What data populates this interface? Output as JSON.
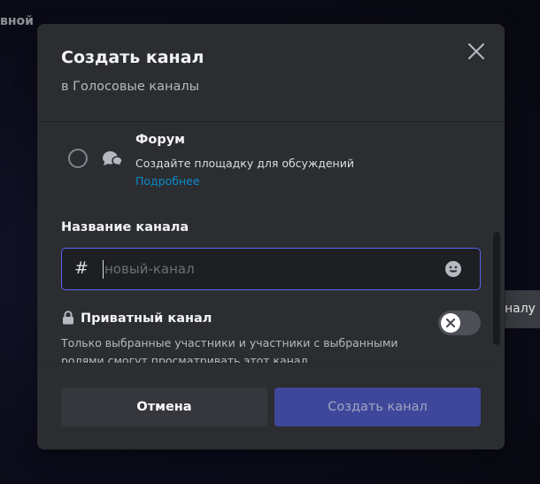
{
  "background": {
    "top_fragment": "вной",
    "right_fragment": "налу"
  },
  "modal": {
    "title": "Создать канал",
    "subtitle": "в Голосовые каналы",
    "close_icon": "close-icon"
  },
  "forum_option": {
    "title": "Форум",
    "description": "Создайте площадку для обсуждений",
    "link": "Подробнее",
    "icon": "forum-icon",
    "selected": false
  },
  "channel_name": {
    "label": "Название канала",
    "prefix": "#",
    "placeholder": "новый-канал",
    "value": ""
  },
  "private_channel": {
    "title": "Приватный канал",
    "description": "Только выбранные участники и участники с выбранными ролями смогут просматривать этот канал.",
    "enabled": false
  },
  "footer": {
    "cancel_label": "Отмена",
    "create_label": "Создать канал"
  },
  "colors": {
    "accent": "#5865f2",
    "link": "#00a8fc",
    "modal_bg": "#2b2d31",
    "input_bg": "#1e1f22"
  }
}
